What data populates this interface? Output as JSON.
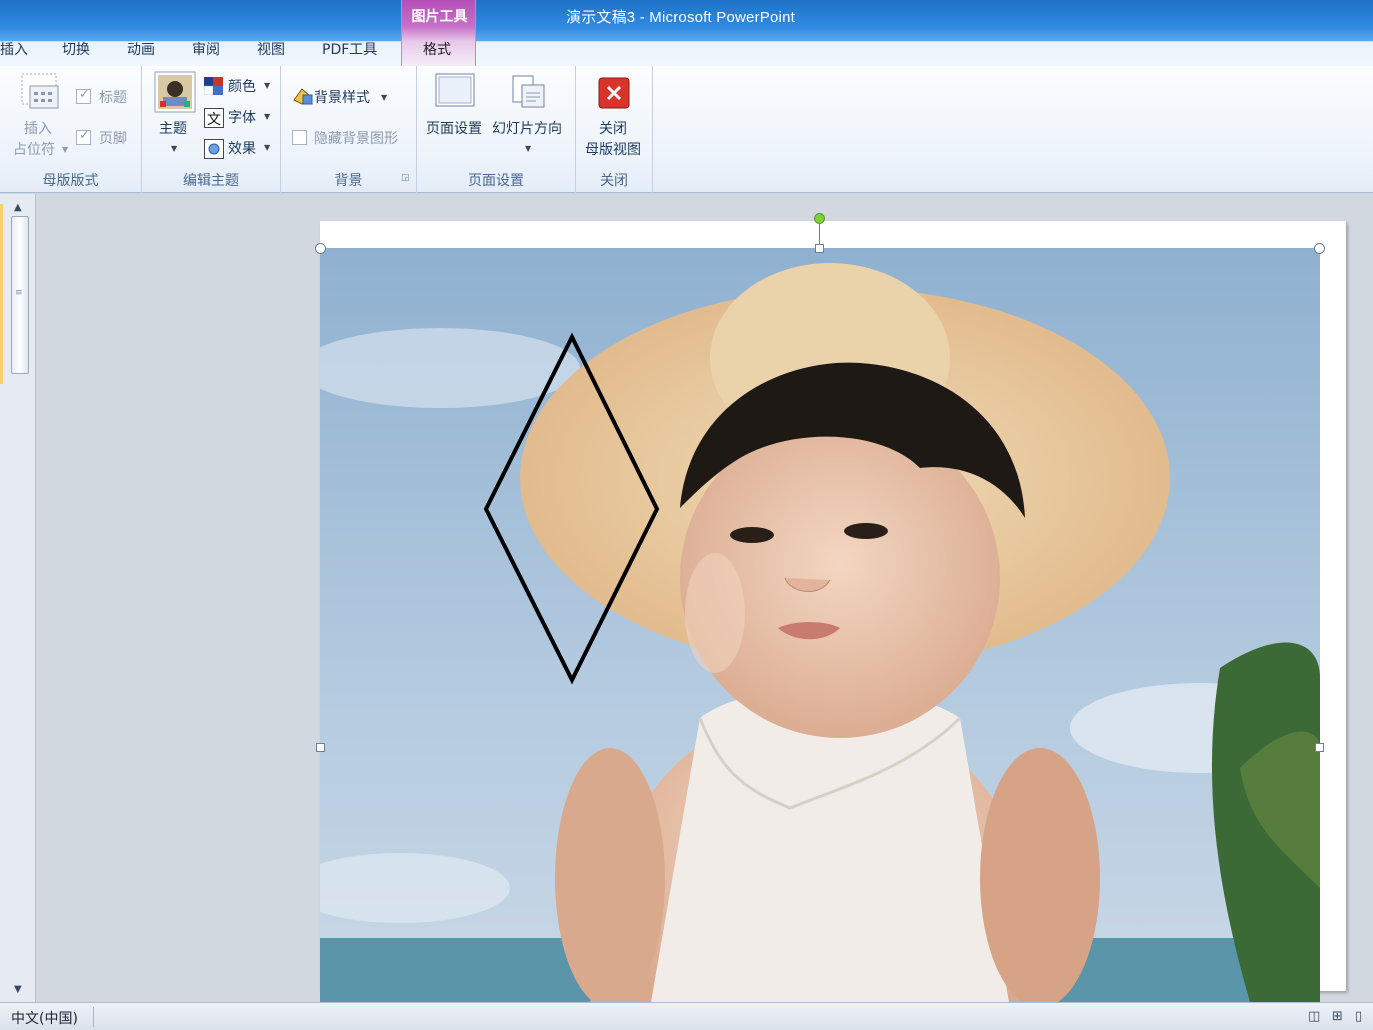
{
  "window": {
    "title": "演示文稿3  -  Microsoft PowerPoint",
    "context_group": "图片工具"
  },
  "tabs": [
    {
      "label": "插入"
    },
    {
      "label": "切换"
    },
    {
      "label": "动画"
    },
    {
      "label": "审阅"
    },
    {
      "label": "视图"
    },
    {
      "label": "PDF工具"
    },
    {
      "label": "格式"
    }
  ],
  "ribbon": {
    "master_layout": {
      "insert_placeholder_line1": "插入",
      "insert_placeholder_line2": "占位符",
      "title_checkbox": "标题",
      "footer_checkbox": "页脚",
      "group_label": "母版版式"
    },
    "edit_theme": {
      "theme_button": "主题",
      "colors": "颜色",
      "fonts": "字体",
      "effects": "效果",
      "group_label": "编辑主题"
    },
    "background": {
      "background_styles": "背景样式",
      "hide_background_graphics": "隐藏背景图形",
      "group_label": "背景"
    },
    "page_setup": {
      "page_setup_button": "页面设置",
      "slide_orientation": "幻灯片方向",
      "group_label": "页面设置"
    },
    "close": {
      "close_line1": "关闭",
      "close_line2": "母版视图",
      "group_label": "关闭"
    }
  },
  "status": {
    "language": "中文(中国)"
  },
  "colors": {
    "titlebar": "#2f8ae0",
    "context_tab": "#b54fb8",
    "ribbon": "#eef4fb",
    "close_icon": "#d9342b",
    "rotation_handle": "#7ed13a"
  }
}
